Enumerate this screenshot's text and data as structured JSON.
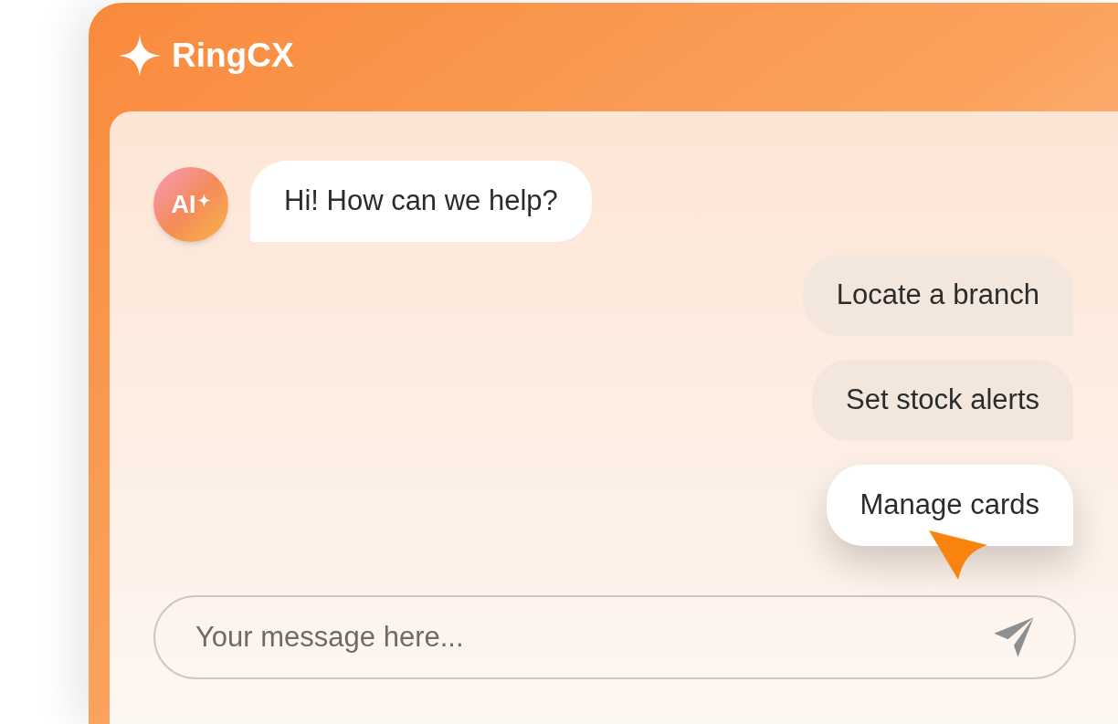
{
  "window": {
    "title": "RingCX"
  },
  "messages": [
    {
      "kind": "bot",
      "avatar": "AI",
      "text": "Hi! How can we help?"
    }
  ],
  "options": [
    {
      "label": "Locate a branch",
      "selected": false
    },
    {
      "label": "Set stock alerts",
      "selected": false
    },
    {
      "label": "Manage cards",
      "selected": true
    }
  ],
  "composer": {
    "placeholder": "Your message here..."
  }
}
